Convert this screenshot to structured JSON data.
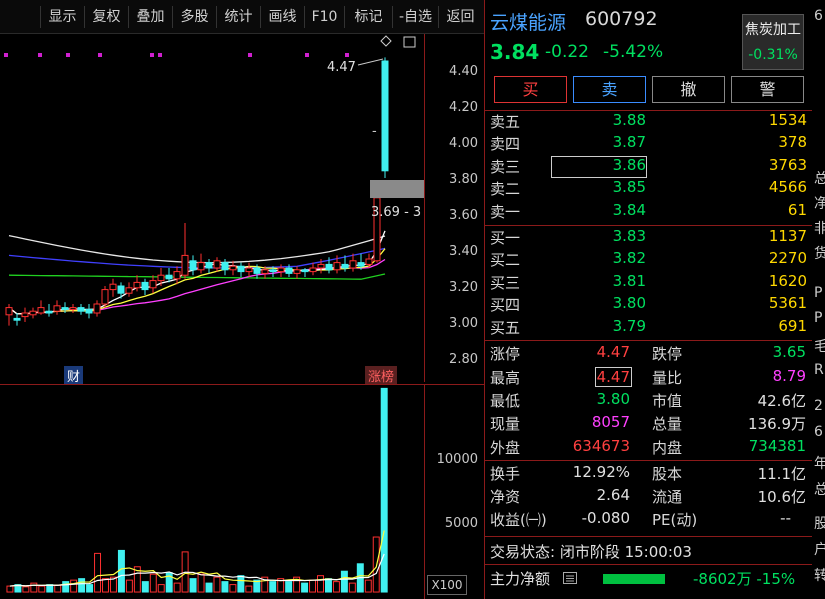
{
  "toolbar": {
    "items": [
      "显示",
      "复权",
      "叠加",
      "多股",
      "统计",
      "画线",
      "F10",
      "标记",
      "-自选",
      "返回"
    ]
  },
  "price_axis": [
    "4.40",
    "4.20",
    "4.00",
    "3.80",
    "3.60",
    "3.40",
    "3.20",
    "3.00",
    "2.80"
  ],
  "volume_axis": [
    "10000",
    "5000"
  ],
  "volume_unit": "X100",
  "chart_labels": {
    "high_marker": "4.47",
    "cursor_price": "3.69 - 3",
    "tag_finance": "财",
    "tag_limitup": "涨榜"
  },
  "quote": {
    "name": "云煤能源",
    "code": "600792",
    "price": "3.84",
    "change": "-0.22",
    "change_pct": "-5.42%",
    "sector_name": "焦炭加工",
    "sector_pct": "-0.31%"
  },
  "trade_buttons": {
    "buy": "买",
    "sell": "卖",
    "cancel": "撤",
    "alert": "警"
  },
  "asks": [
    {
      "label": "卖五",
      "price": "3.88",
      "qty": "1534"
    },
    {
      "label": "卖四",
      "price": "3.87",
      "qty": "378"
    },
    {
      "label": "卖三",
      "price": "3.86",
      "qty": "3763"
    },
    {
      "label": "卖二",
      "price": "3.85",
      "qty": "4566"
    },
    {
      "label": "卖一",
      "price": "3.84",
      "qty": "61"
    }
  ],
  "bids": [
    {
      "label": "买一",
      "price": "3.83",
      "qty": "1137"
    },
    {
      "label": "买二",
      "price": "3.82",
      "qty": "2270"
    },
    {
      "label": "买三",
      "price": "3.81",
      "qty": "1620"
    },
    {
      "label": "买四",
      "price": "3.80",
      "qty": "5361"
    },
    {
      "label": "买五",
      "price": "3.79",
      "qty": "691"
    }
  ],
  "stats": {
    "limit_up_label": "涨停",
    "limit_up": "4.47",
    "limit_down_label": "跌停",
    "limit_down": "3.65",
    "high_label": "最高",
    "high": "4.47",
    "vol_ratio_label": "量比",
    "vol_ratio": "8.79",
    "low_label": "最低",
    "low": "3.80",
    "mkt_cap_label": "市值",
    "mkt_cap": "42.6亿",
    "cur_vol_label": "现量",
    "cur_vol": "8057",
    "total_vol_label": "总量",
    "total_vol": "136.9万",
    "outer_label": "外盘",
    "outer": "634673",
    "inner_label": "内盘",
    "inner": "734381",
    "turnover_label": "换手",
    "turnover": "12.92%",
    "shares_label": "股本",
    "shares": "11.1亿",
    "nav_label": "净资",
    "nav": "2.64",
    "float_label": "流通",
    "float": "10.6亿",
    "eps_label": "收益(㈠)",
    "eps": "-0.080",
    "pe_label": "PE(动)",
    "pe": "--"
  },
  "status_text": "交易状态: 闭市阶段 15:00:03",
  "main_flow": {
    "label": "主力净额",
    "value": "-8602万",
    "pct": "-15%"
  },
  "edge_chars": [
    "6",
    "总",
    "净",
    "非",
    "货",
    "P",
    "P",
    "毛",
    "R",
    "2",
    "6",
    "年",
    "总",
    "股",
    "户",
    "转"
  ],
  "chart_data": {
    "type": "candlestick",
    "ylim": [
      2.7,
      4.5
    ],
    "volume_max": 14000,
    "candles": [
      [
        3.04,
        3.08,
        3.1,
        2.98
      ],
      [
        3.02,
        3.01,
        3.05,
        2.98
      ],
      [
        3.03,
        3.05,
        3.08,
        3.0
      ],
      [
        3.04,
        3.06,
        3.08,
        3.02
      ],
      [
        3.05,
        3.08,
        3.12,
        3.04
      ],
      [
        3.06,
        3.05,
        3.1,
        3.03
      ],
      [
        3.06,
        3.09,
        3.12,
        3.04
      ],
      [
        3.08,
        3.07,
        3.11,
        3.05
      ],
      [
        3.07,
        3.08,
        3.1,
        3.05
      ],
      [
        3.08,
        3.06,
        3.1,
        3.04
      ],
      [
        3.07,
        3.05,
        3.1,
        3.02
      ],
      [
        3.05,
        3.1,
        3.12,
        3.03
      ],
      [
        3.1,
        3.18,
        3.2,
        3.08
      ],
      [
        3.18,
        3.21,
        3.24,
        3.14
      ],
      [
        3.2,
        3.16,
        3.22,
        3.13
      ],
      [
        3.16,
        3.19,
        3.22,
        3.14
      ],
      [
        3.19,
        3.22,
        3.26,
        3.17
      ],
      [
        3.22,
        3.18,
        3.24,
        3.15
      ],
      [
        3.19,
        3.23,
        3.26,
        3.16
      ],
      [
        3.23,
        3.26,
        3.3,
        3.2
      ],
      [
        3.26,
        3.24,
        3.3,
        3.22
      ],
      [
        3.24,
        3.28,
        3.31,
        3.21
      ],
      [
        3.26,
        3.37,
        3.55,
        3.24
      ],
      [
        3.34,
        3.29,
        3.37,
        3.26
      ],
      [
        3.29,
        3.33,
        3.38,
        3.27
      ],
      [
        3.33,
        3.3,
        3.35,
        3.27
      ],
      [
        3.3,
        3.34,
        3.36,
        3.28
      ],
      [
        3.33,
        3.29,
        3.35,
        3.26
      ],
      [
        3.29,
        3.31,
        3.34,
        3.26
      ],
      [
        3.31,
        3.28,
        3.33,
        3.25
      ],
      [
        3.28,
        3.3,
        3.33,
        3.25
      ],
      [
        3.3,
        3.27,
        3.32,
        3.24
      ],
      [
        3.27,
        3.29,
        3.31,
        3.24
      ],
      [
        3.29,
        3.28,
        3.31,
        3.25
      ],
      [
        3.28,
        3.3,
        3.32,
        3.25
      ],
      [
        3.3,
        3.27,
        3.32,
        3.25
      ],
      [
        3.27,
        3.29,
        3.31,
        3.24
      ],
      [
        3.29,
        3.28,
        3.3,
        3.25
      ],
      [
        3.28,
        3.3,
        3.33,
        3.26
      ],
      [
        3.3,
        3.32,
        3.35,
        3.27
      ],
      [
        3.32,
        3.29,
        3.36,
        3.27
      ],
      [
        3.29,
        3.33,
        3.37,
        3.27
      ],
      [
        3.32,
        3.3,
        3.37,
        3.28
      ],
      [
        3.3,
        3.34,
        3.38,
        3.28
      ],
      [
        3.33,
        3.31,
        3.38,
        3.29
      ],
      [
        3.32,
        3.35,
        3.38,
        3.3
      ],
      [
        3.34,
        3.69,
        3.7,
        3.33
      ],
      [
        4.45,
        3.84,
        4.47,
        3.8
      ]
    ],
    "volumes": [
      400,
      500,
      350,
      600,
      400,
      500,
      450,
      700,
      800,
      900,
      500,
      2600,
      900,
      1000,
      2800,
      800,
      1700,
      700,
      1200,
      500,
      1300,
      600,
      2700,
      900,
      1200,
      600,
      1000,
      700,
      500,
      1100,
      400,
      800,
      1000,
      700,
      900,
      700,
      1000,
      600,
      800,
      1100,
      900,
      700,
      1400,
      600,
      1900,
      800,
      3700,
      13700
    ]
  }
}
